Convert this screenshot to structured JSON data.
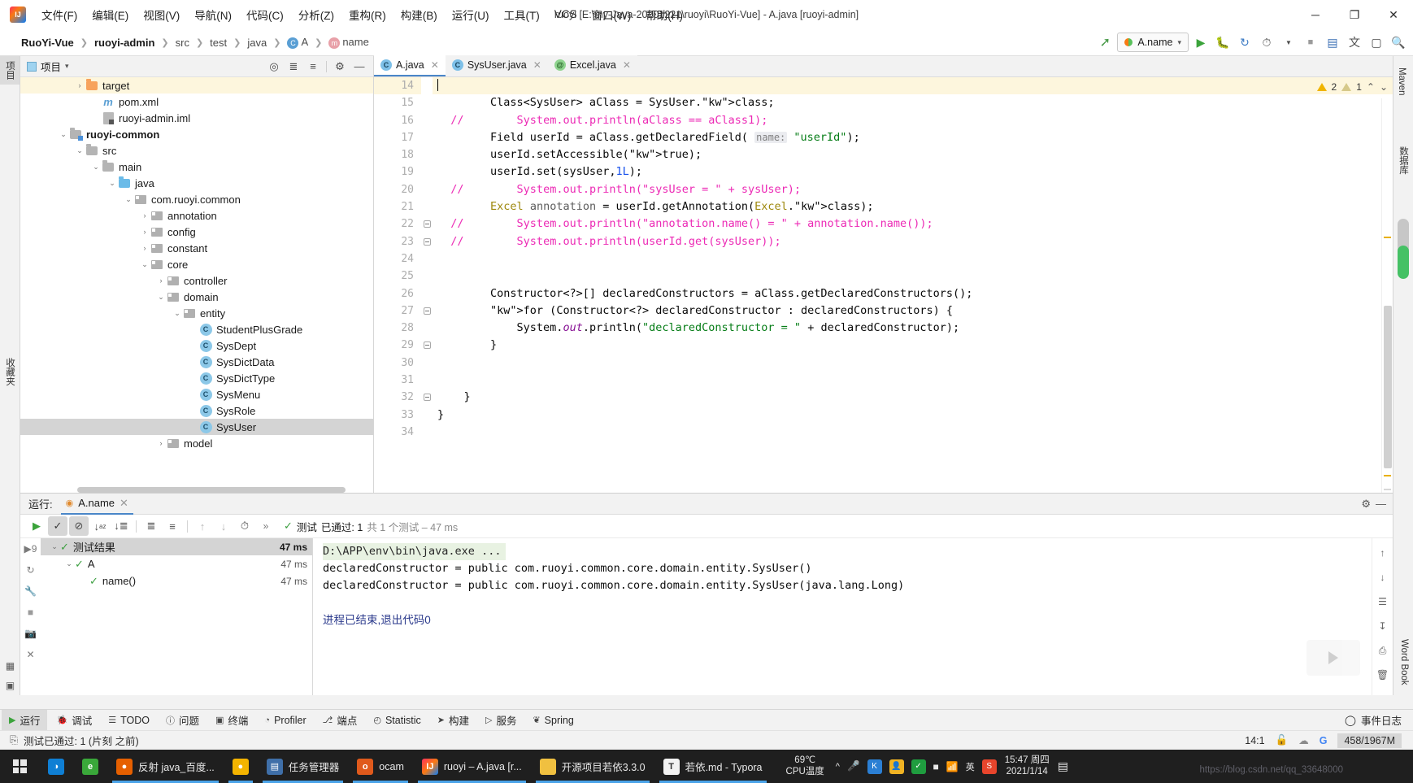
{
  "titlebar": {
    "window_title": "ruoyi [E:\\my-Java-20201221\\ruoyi\\RuoYi-Vue] - A.java [ruoyi-admin]",
    "menu": [
      "文件(F)",
      "编辑(E)",
      "视图(V)",
      "导航(N)",
      "代码(C)",
      "分析(Z)",
      "重构(R)",
      "构建(B)",
      "运行(U)",
      "工具(T)",
      "VCS",
      "窗口(W)",
      "帮助(H)"
    ],
    "controls": {
      "minimize": "─",
      "maximize": "❐",
      "close": "✕"
    }
  },
  "navbar": {
    "breadcrumbs": [
      {
        "label": "RuoYi-Vue",
        "bold": true
      },
      {
        "label": "ruoyi-admin",
        "bold": true
      },
      {
        "label": "src",
        "bold": false
      },
      {
        "label": "test",
        "bold": false
      },
      {
        "label": "java",
        "bold": false
      },
      {
        "label": "A",
        "bold": false,
        "icon": "class-icon"
      },
      {
        "label": "name",
        "bold": false,
        "icon": "method-icon"
      }
    ],
    "run_config": "A.name",
    "dropdown_caret": "▾",
    "icons": [
      "build-icon",
      "run-icon",
      "debug-icon",
      "run-coverage-icon",
      "profile-icon",
      "stop-icon",
      "layout-icon",
      "translate-icon",
      "terminal-icon",
      "search-icon"
    ]
  },
  "left_strip": {
    "tabs": [
      {
        "label": "项目",
        "active": true
      },
      {
        "label": "收藏夹",
        "active": false
      }
    ]
  },
  "project_panel": {
    "title": "项目",
    "caret": "▾",
    "header_icons": [
      "locate-icon",
      "expand-all-icon",
      "collapse-all-icon",
      "settings-icon",
      "hide-icon"
    ],
    "tree": [
      {
        "label": "target",
        "indent": 3,
        "arrow": "›",
        "icon": "folder-orange",
        "state": "highlight"
      },
      {
        "label": "pom.xml",
        "indent": 4,
        "arrow": "",
        "icon": "maven-file",
        "state": ""
      },
      {
        "label": "ruoyi-admin.iml",
        "indent": 4,
        "arrow": "",
        "icon": "iml-file",
        "state": ""
      },
      {
        "label": "ruoyi-common",
        "indent": 2,
        "arrow": "⌄",
        "icon": "module-folder",
        "state": "",
        "bold": true
      },
      {
        "label": "src",
        "indent": 3,
        "arrow": "⌄",
        "icon": "folder-gray",
        "state": ""
      },
      {
        "label": "main",
        "indent": 4,
        "arrow": "⌄",
        "icon": "folder-gray",
        "state": ""
      },
      {
        "label": "java",
        "indent": 5,
        "arrow": "⌄",
        "icon": "folder-blue",
        "state": ""
      },
      {
        "label": "com.ruoyi.common",
        "indent": 6,
        "arrow": "⌄",
        "icon": "package",
        "state": ""
      },
      {
        "label": "annotation",
        "indent": 7,
        "arrow": "›",
        "icon": "package",
        "state": ""
      },
      {
        "label": "config",
        "indent": 7,
        "arrow": "›",
        "icon": "package",
        "state": ""
      },
      {
        "label": "constant",
        "indent": 7,
        "arrow": "›",
        "icon": "package",
        "state": ""
      },
      {
        "label": "core",
        "indent": 7,
        "arrow": "⌄",
        "icon": "package",
        "state": ""
      },
      {
        "label": "controller",
        "indent": 8,
        "arrow": "›",
        "icon": "package",
        "state": ""
      },
      {
        "label": "domain",
        "indent": 8,
        "arrow": "⌄",
        "icon": "package",
        "state": ""
      },
      {
        "label": "entity",
        "indent": 9,
        "arrow": "⌄",
        "icon": "package",
        "state": ""
      },
      {
        "label": "StudentPlusGrade",
        "indent": 10,
        "arrow": "",
        "icon": "java-class",
        "state": ""
      },
      {
        "label": "SysDept",
        "indent": 10,
        "arrow": "",
        "icon": "java-class",
        "state": ""
      },
      {
        "label": "SysDictData",
        "indent": 10,
        "arrow": "",
        "icon": "java-class",
        "state": ""
      },
      {
        "label": "SysDictType",
        "indent": 10,
        "arrow": "",
        "icon": "java-class",
        "state": ""
      },
      {
        "label": "SysMenu",
        "indent": 10,
        "arrow": "",
        "icon": "java-class",
        "state": ""
      },
      {
        "label": "SysRole",
        "indent": 10,
        "arrow": "",
        "icon": "java-class",
        "state": ""
      },
      {
        "label": "SysUser",
        "indent": 10,
        "arrow": "",
        "icon": "java-class",
        "state": "selected"
      },
      {
        "label": "model",
        "indent": 8,
        "arrow": "›",
        "icon": "package",
        "state": ""
      }
    ]
  },
  "editor": {
    "tabs": [
      {
        "label": "A.java",
        "icon": "java-class-test-icon",
        "active": true,
        "close": "✕"
      },
      {
        "label": "SysUser.java",
        "icon": "java-class-icon",
        "active": false,
        "close": "✕"
      },
      {
        "label": "Excel.java",
        "icon": "java-annotation-icon",
        "active": false,
        "close": "✕"
      }
    ],
    "inspections": {
      "warnings": "2",
      "weak_warnings": "1",
      "up": "⌃",
      "down": "⌄"
    },
    "first_line_number": 14,
    "lines": [
      {
        "n": 14,
        "text": "",
        "cursor": true,
        "current": true
      },
      {
        "n": 15,
        "text": "        Class<SysUser> aClass = SysUser.class;"
      },
      {
        "n": 16,
        "text": "          System.out.println(aClass == aClass1);",
        "comment": true
      },
      {
        "n": 17,
        "text": "        Field userId = aClass.getDeclaredField( name: \"userId\");"
      },
      {
        "n": 18,
        "text": "        userId.setAccessible(true);"
      },
      {
        "n": 19,
        "text": "        userId.set(sysUser,1L);"
      },
      {
        "n": 20,
        "text": "          System.out.println(\"sysUser = \" + sysUser);",
        "comment": true
      },
      {
        "n": 21,
        "text": "        Excel annotation = userId.getAnnotation(Excel.class);"
      },
      {
        "n": 22,
        "text": "          System.out.println(\"annotation.name() = \" + annotation.name());",
        "comment": true,
        "fold": true
      },
      {
        "n": 23,
        "text": "          System.out.println(userId.get(sysUser));",
        "comment": true,
        "fold": true
      },
      {
        "n": 24,
        "text": ""
      },
      {
        "n": 25,
        "text": ""
      },
      {
        "n": 26,
        "text": "        Constructor<?>[] declaredConstructors = aClass.getDeclaredConstructors();"
      },
      {
        "n": 27,
        "text": "        for (Constructor<?> declaredConstructor : declaredConstructors) {",
        "fold": true
      },
      {
        "n": 28,
        "text": "            System.out.println(\"declaredConstructor = \" + declaredConstructor);"
      },
      {
        "n": 29,
        "text": "        }",
        "fold": true
      },
      {
        "n": 30,
        "text": ""
      },
      {
        "n": 31,
        "text": ""
      },
      {
        "n": 32,
        "text": "    }",
        "fold": true
      },
      {
        "n": 33,
        "text": "}"
      },
      {
        "n": 34,
        "text": ""
      }
    ]
  },
  "right_strip": {
    "tabs": [
      "Maven",
      "数据库"
    ],
    "bottom_tabs": [
      "Word Book"
    ]
  },
  "run_panel": {
    "label": "运行:",
    "tab": "A.name",
    "tab_close": "✕",
    "toolbar_icons": [
      "rerun-icon",
      "show-passed-icon",
      "hide-ignored-icon",
      "sort-alpha-icon",
      "sort-duration-icon",
      "expand-all-icon",
      "collapse-all-icon",
      "prev-failed-icon",
      "next-failed-icon",
      "history-icon",
      "more-icon"
    ],
    "status_prefix": "测试",
    "status_main": "已通过: 1",
    "status_detail": "共 1 个测试 – 47 ms",
    "tree": [
      {
        "label": "测试结果",
        "time": "47 ms",
        "indent": 0,
        "arrow": "⌄",
        "selected": true,
        "bold_time": true
      },
      {
        "label": "A",
        "time": "47 ms",
        "indent": 1,
        "arrow": "⌄",
        "selected": false,
        "bold_time": false
      },
      {
        "label": "name()",
        "time": "47 ms",
        "indent": 2,
        "arrow": "",
        "selected": false,
        "bold_time": false
      }
    ],
    "console": [
      {
        "text": "D:\\APP\\env\\bin\\java.exe ...",
        "type": "command"
      },
      {
        "text": "declaredConstructor = public com.ruoyi.common.core.domain.entity.SysUser()",
        "type": "out"
      },
      {
        "text": "declaredConstructor = public com.ruoyi.common.core.domain.entity.SysUser(java.lang.Long)",
        "type": "out"
      },
      {
        "text": "",
        "type": "out"
      },
      {
        "text": "进程已结束,退出代码0",
        "type": "end"
      }
    ],
    "toast": "测试已通过: 1"
  },
  "bottom_bar": {
    "items": [
      {
        "label": "运行",
        "icon": "run-icon",
        "active": true
      },
      {
        "label": "调试",
        "icon": "debug-icon",
        "active": false
      },
      {
        "label": "TODO",
        "icon": "todo-icon",
        "active": false
      },
      {
        "label": "问题",
        "icon": "problems-icon",
        "active": false
      },
      {
        "label": "终端",
        "icon": "terminal-icon",
        "active": false
      },
      {
        "label": "Profiler",
        "icon": "profiler-icon",
        "active": false
      },
      {
        "label": "端点",
        "icon": "endpoints-icon",
        "active": false
      },
      {
        "label": "Statistic",
        "icon": "statistic-icon",
        "active": false
      },
      {
        "label": "构建",
        "icon": "build-icon",
        "active": false
      },
      {
        "label": "服务",
        "icon": "services-icon",
        "active": false
      },
      {
        "label": "Spring",
        "icon": "spring-icon",
        "active": false
      }
    ],
    "event_log": "事件日志"
  },
  "status_bar": {
    "message": "测试已通过: 1 (片刻 之前)",
    "caret_position": "14:1",
    "memory": "458/1967M",
    "icons": [
      "lock-icon",
      "cloud-settings-icon",
      "google-icon"
    ]
  },
  "taskbar": {
    "apps": [
      {
        "label": "",
        "icon": "edge-icon",
        "running": false
      },
      {
        "label": "",
        "icon": "ie-icon",
        "running": false
      },
      {
        "label": "反射 java_百度...",
        "icon": "firefox-icon",
        "running": true
      },
      {
        "label": "",
        "icon": "chrome-icon",
        "running": true
      },
      {
        "label": "任务管理器",
        "icon": "taskmgr-icon",
        "running": true
      },
      {
        "label": "ocam",
        "icon": "ocam-icon",
        "running": true
      },
      {
        "label": "ruoyi – A.java [r...",
        "icon": "idea-icon",
        "running": true,
        "active": true
      },
      {
        "label": "开源项目若依3.3.0",
        "icon": "folder-icon",
        "running": true
      },
      {
        "label": "若依.md - Typora",
        "icon": "typora-icon",
        "running": true
      }
    ],
    "cpu_temp_value": "69℃",
    "cpu_temp_label": "CPU温度",
    "tray_icons": [
      "chevron-up-icon",
      "microphone-icon",
      "kingsoft-icon",
      "qq-icon",
      "shield-icon",
      "battery-icon",
      "network-icon",
      "ime-icon",
      "sogou-icon"
    ],
    "clock_time": "15:47 周四",
    "clock_date": "2021/1/14",
    "notification": "▤",
    "watermark": "https://blog.csdn.net/qq_33648000"
  }
}
